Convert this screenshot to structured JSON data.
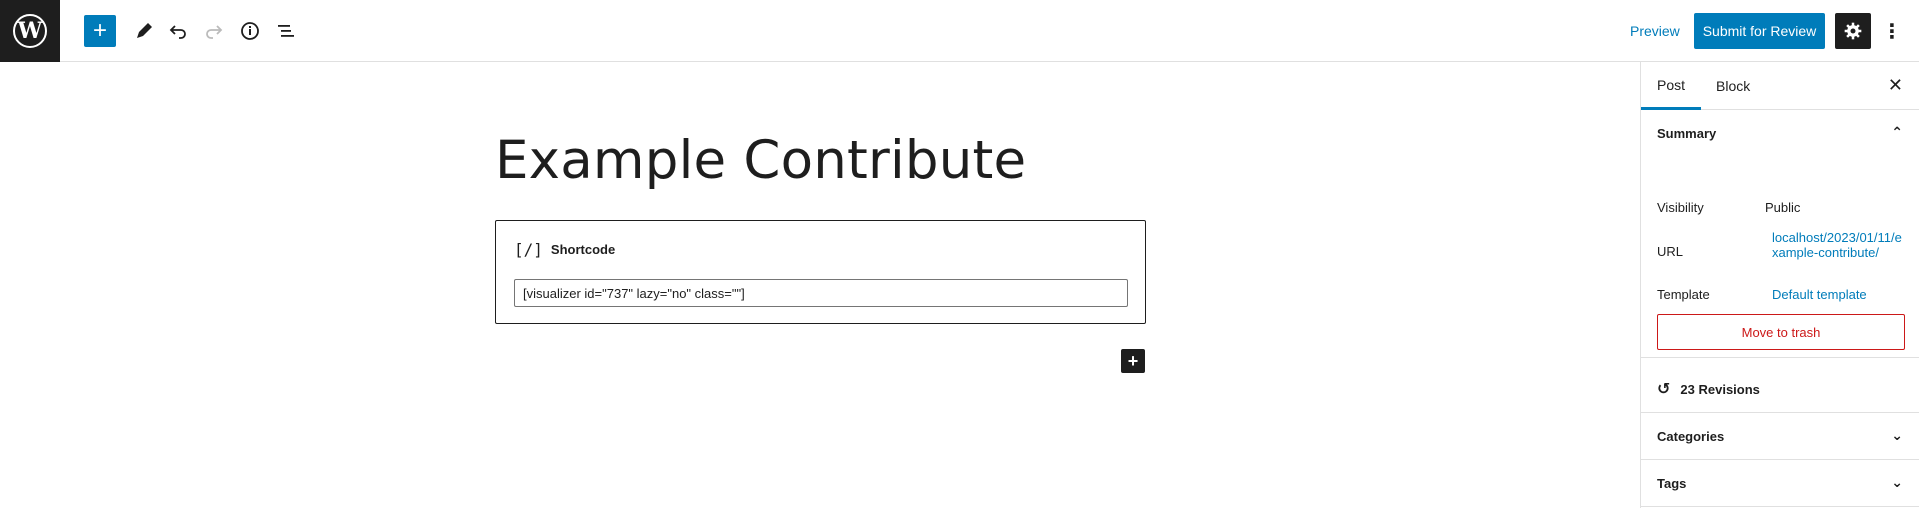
{
  "toolbar": {
    "logo_icon": "wordpress-logo-icon",
    "add_icon": "plus-icon",
    "tools_icon": "pencil-icon",
    "undo_icon": "undo-icon",
    "redo_icon": "redo-icon",
    "details_icon": "info-icon",
    "outline_icon": "list-view-icon",
    "preview_label": "Preview",
    "submit_label": "Submit for Review",
    "settings_icon": "gear-icon",
    "more_icon": "more-vertical-icon",
    "accent": "#007cba"
  },
  "editor": {
    "title": "Example Contribute",
    "block": {
      "icon": "[/]",
      "label": "Shortcode",
      "value": "[visualizer id=\"737\" lazy=\"no\" class=\"\"]"
    },
    "inserter_icon": "plus-icon"
  },
  "sidebar": {
    "tabs": [
      {
        "label": "Post",
        "active": true
      },
      {
        "label": "Block",
        "active": false
      }
    ],
    "close_icon": "close-icon",
    "summary": {
      "title": "Summary",
      "visibility_label": "Visibility",
      "visibility_value": "Public",
      "url_label": "URL",
      "url_value": "localhost/2023/01/11/example-contribute/",
      "template_label": "Template",
      "template_value": "Default template",
      "trash_label": "Move to trash"
    },
    "revisions": "23 Revisions",
    "categories": "Categories",
    "tags": "Tags"
  }
}
